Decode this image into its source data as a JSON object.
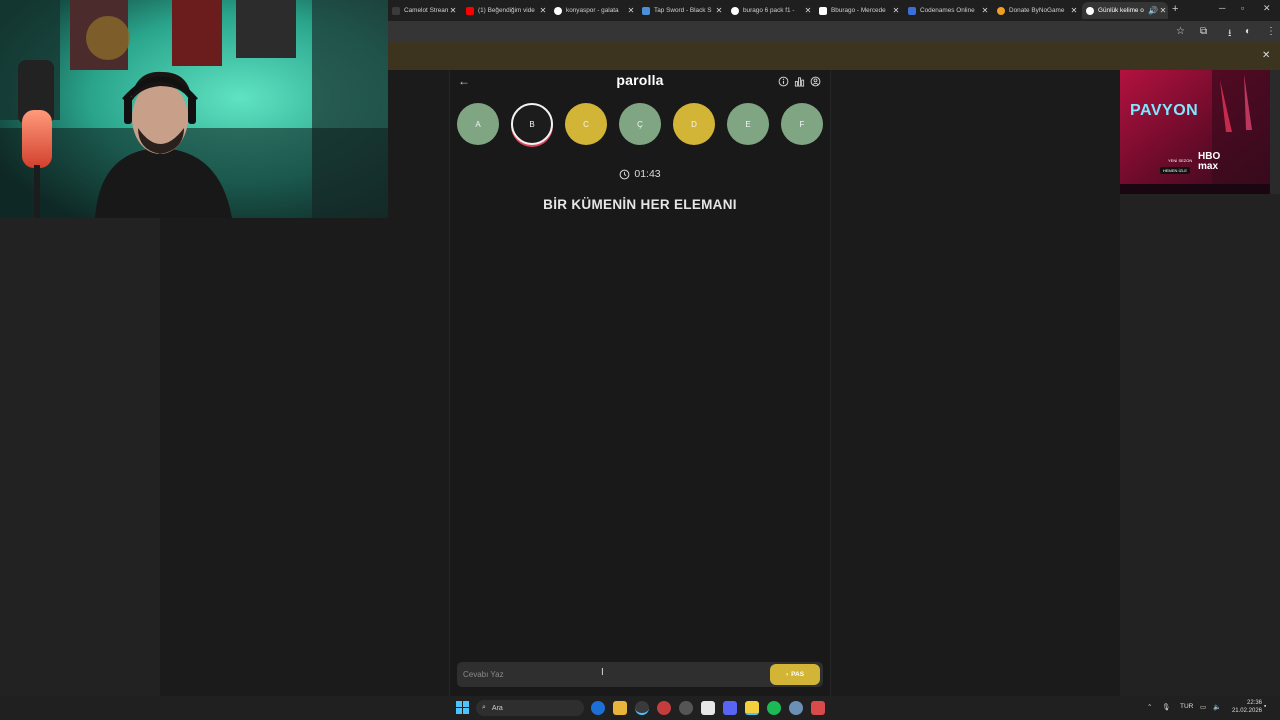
{
  "browser": {
    "tabs": [
      {
        "label": "Camelot Stream - V",
        "fav_color": "#3a3a3a"
      },
      {
        "label": "(1) Beğendiğim vide",
        "fav_color": "#ff0000"
      },
      {
        "label": "konyaspor - galata",
        "fav_color": "#ffffff"
      },
      {
        "label": "Tap Sword - Black S",
        "fav_color": "#4a90d9"
      },
      {
        "label": "burago 6 pack f1 - ",
        "fav_color": "#ffffff"
      },
      {
        "label": "Bburago - Mercede",
        "fav_color": "#ffffff"
      },
      {
        "label": "Codenames Online",
        "fav_color": "#3b6fd6"
      },
      {
        "label": "Donate ByNoGame",
        "fav_color": "#f0a020"
      },
      {
        "label": "Günlük kelime o",
        "fav_color": "#ffffff"
      }
    ]
  },
  "game": {
    "brand": "parolla",
    "letters": [
      {
        "letter": "A",
        "state": "green"
      },
      {
        "letter": "B",
        "state": "active"
      },
      {
        "letter": "C",
        "state": "gold"
      },
      {
        "letter": "Ç",
        "state": "green"
      },
      {
        "letter": "D",
        "state": "gold"
      },
      {
        "letter": "E",
        "state": "green"
      },
      {
        "letter": "F",
        "state": "green"
      }
    ],
    "timer": "01:43",
    "question": "BİR KÜMENİN HER ELEMANI",
    "answer_placeholder": "Cevabı Yaz",
    "pass_label": "PAS"
  },
  "ad": {
    "title": "PAVYON",
    "network": "HBO max",
    "line1": "YENİ SEZON",
    "line2": "HEMEN İZLE"
  },
  "taskbar": {
    "search_label": "Ara",
    "language": "TUR",
    "time": "22:36",
    "date": "21.02.2026"
  },
  "colors": {
    "green": "#7fa583",
    "gold": "#d2b437",
    "accent_ring": "#e0445a"
  }
}
